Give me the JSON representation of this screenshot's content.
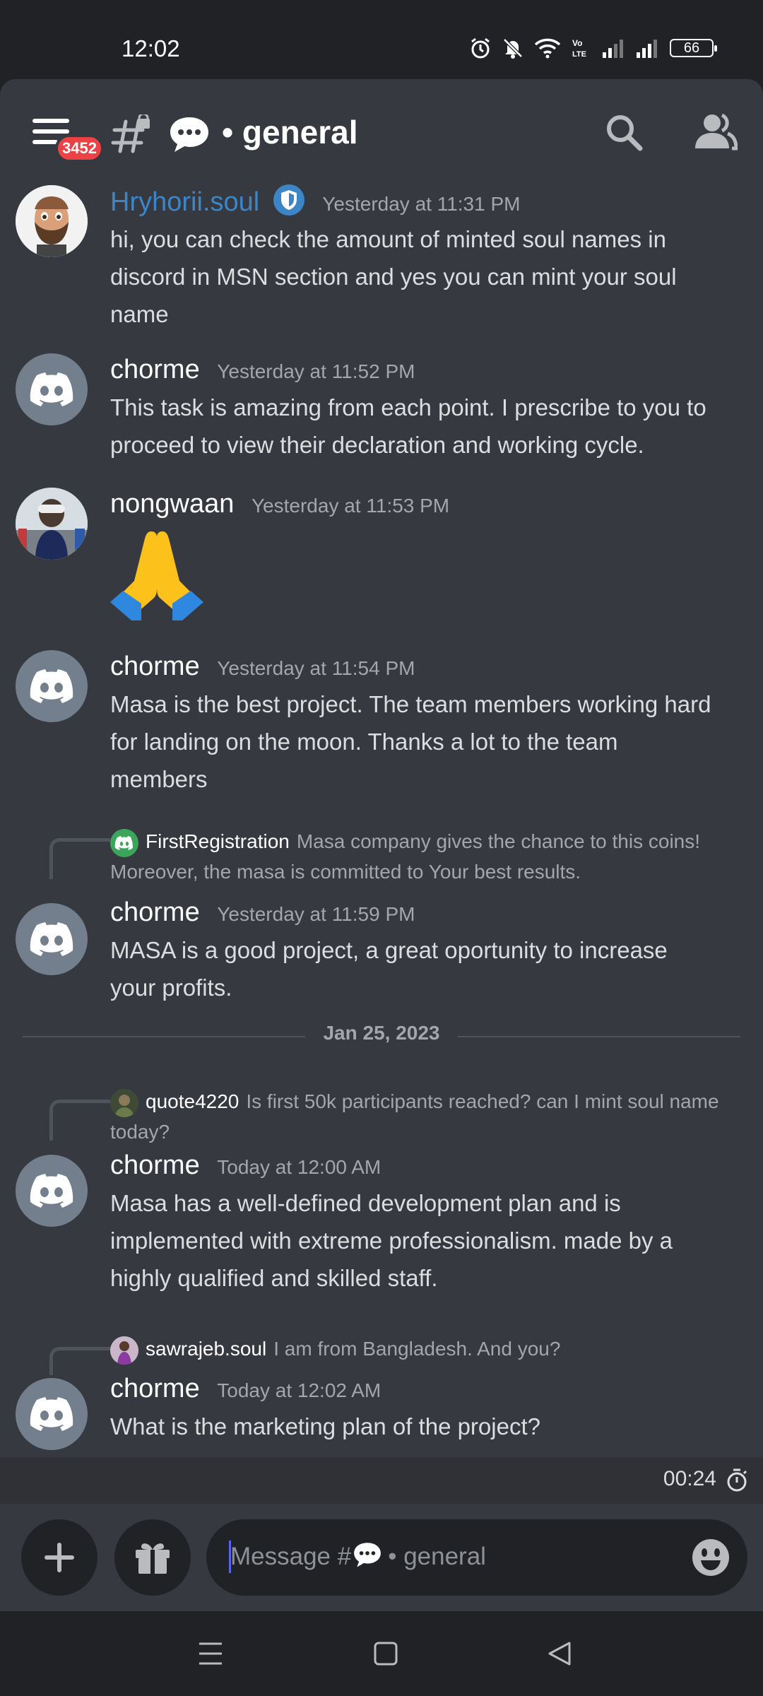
{
  "status_bar": {
    "time": "12:02",
    "battery": "66",
    "icons": [
      "alarm-icon",
      "mute-icon",
      "wifi-icon",
      "volte-icon",
      "signal-icon",
      "signal-icon"
    ]
  },
  "header": {
    "notification_badge": "3452",
    "channel_emoji": "speech-balloon-icon",
    "channel_title": "• general"
  },
  "messages": [
    {
      "author": "Hryhorii.soul",
      "author_color": "#3c86c8",
      "badge": "shield-icon",
      "time": "Yesterday at 11:31 PM",
      "lines": [
        "hi, you can check the amount of minted soul names in",
        "discord in  MSN section  and yes you can mint your soul",
        "name"
      ]
    },
    {
      "author": "chorme",
      "time": "Yesterday at 11:52 PM",
      "lines": [
        "This task is amazing from each point. I prescribe to you to",
        "proceed to view their declaration and working cycle."
      ]
    },
    {
      "author": "nongwaan",
      "time": "Yesterday at 11:53 PM",
      "emoji": "folded-hands-icon"
    },
    {
      "author": "chorme",
      "time": "Yesterday at 11:54 PM",
      "lines": [
        "Masa is the best project. The team members working hard",
        "for landing on the moon. Thanks a lot to the team",
        "members"
      ]
    },
    {
      "author": "chorme",
      "time": "Yesterday at 11:59 PM",
      "reply": {
        "name": "FirstRegistration",
        "text": "Masa company gives the chance to this coins! Moreover, the masa is committed to Your best results."
      },
      "lines": [
        "MASA is a good project, a great oportunity to increase",
        "your profits."
      ]
    },
    {
      "author": "chorme",
      "time": "Today at 12:00 AM",
      "reply": {
        "name": "quote4220",
        "text": "Is first 50k participants reached? can I mint soul name today?"
      },
      "lines": [
        "Masa has a well-defined development plan and is",
        "implemented with extreme professionalism. made by a",
        "highly qualified and skilled staff."
      ]
    },
    {
      "author": "chorme",
      "time": "Today at 12:02 AM",
      "reply": {
        "name": "sawrajeb.soul",
        "text": "I am from Bangladesh. And you?"
      },
      "lines": [
        "What is the marketing plan of the project?"
      ]
    }
  ],
  "date_divider": "Jan 25, 2023",
  "timer": "00:24",
  "composer": {
    "placeholder_prefix": "Message #",
    "placeholder_suffix": "• general"
  }
}
